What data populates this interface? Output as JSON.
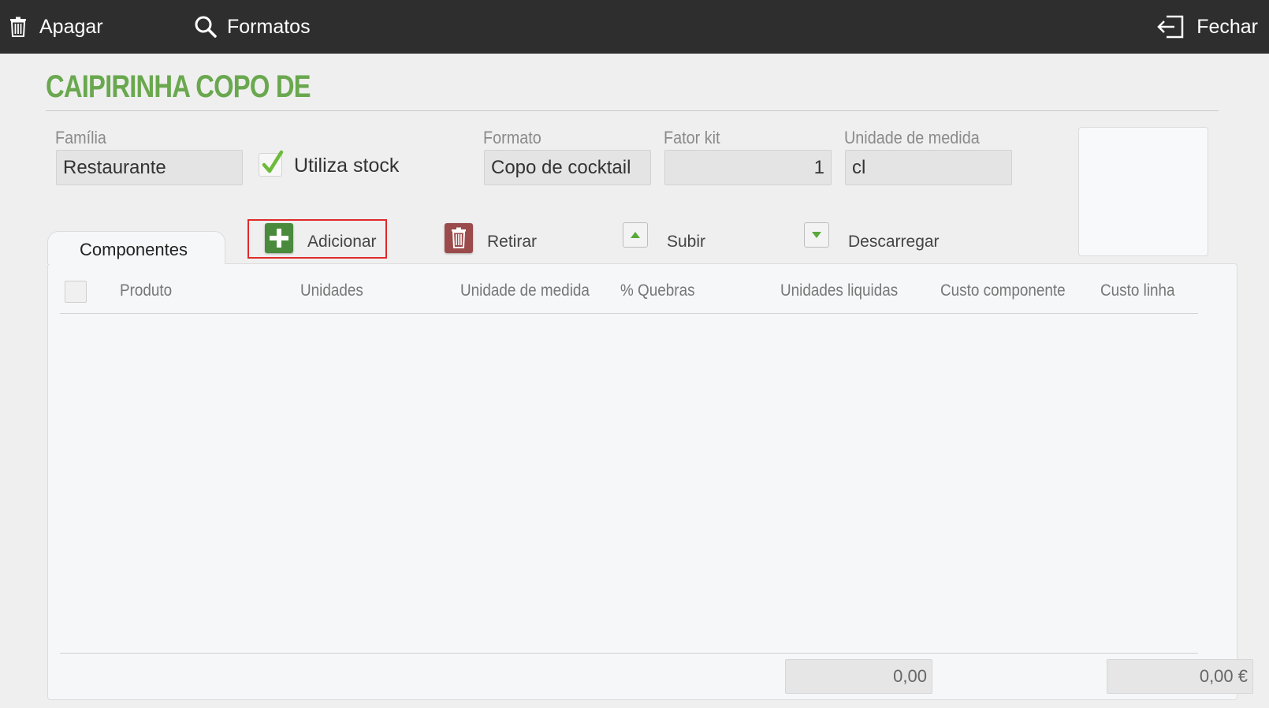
{
  "toolbar": {
    "delete_label": "Apagar",
    "delete_icon": "trash-icon",
    "formats_label": "Formatos",
    "formats_icon": "search-icon",
    "close_label": "Fechar",
    "close_icon": "exit-icon",
    "background": "#2e2e2e"
  },
  "product": {
    "title": "CAIPIRINHA COPO DE",
    "title_color": "#6aa84f"
  },
  "form": {
    "family": {
      "label": "Família",
      "value": "Restaurante"
    },
    "uses_stock": {
      "label": "Utiliza stock",
      "checked": true
    },
    "format": {
      "label": "Formato",
      "value": "Copo de cocktail"
    },
    "kit_factor": {
      "label": "Fator kit",
      "value": "1"
    },
    "unit": {
      "label": "Unidade de medida",
      "value": "cl"
    }
  },
  "tabs": [
    {
      "label": "Componentes",
      "active": true
    }
  ],
  "actions": {
    "add": {
      "label": "Adicionar",
      "icon": "plus-icon",
      "color": "#4a8a3c"
    },
    "remove": {
      "label": "Retirar",
      "icon": "trash-icon",
      "color": "#9b4b4b"
    },
    "up": {
      "label": "Subir",
      "icon": "arrow-up-icon"
    },
    "down": {
      "label": "Descarregar",
      "icon": "arrow-down-icon"
    }
  },
  "table": {
    "columns": [
      "Produto",
      "Unidades",
      "Unidade de medida",
      "% Quebras",
      "Unidades liquidas",
      "Custo componente",
      "Custo linha"
    ],
    "rows": []
  },
  "totals": {
    "net_units": "0,00",
    "line_cost": "0,00 €"
  }
}
